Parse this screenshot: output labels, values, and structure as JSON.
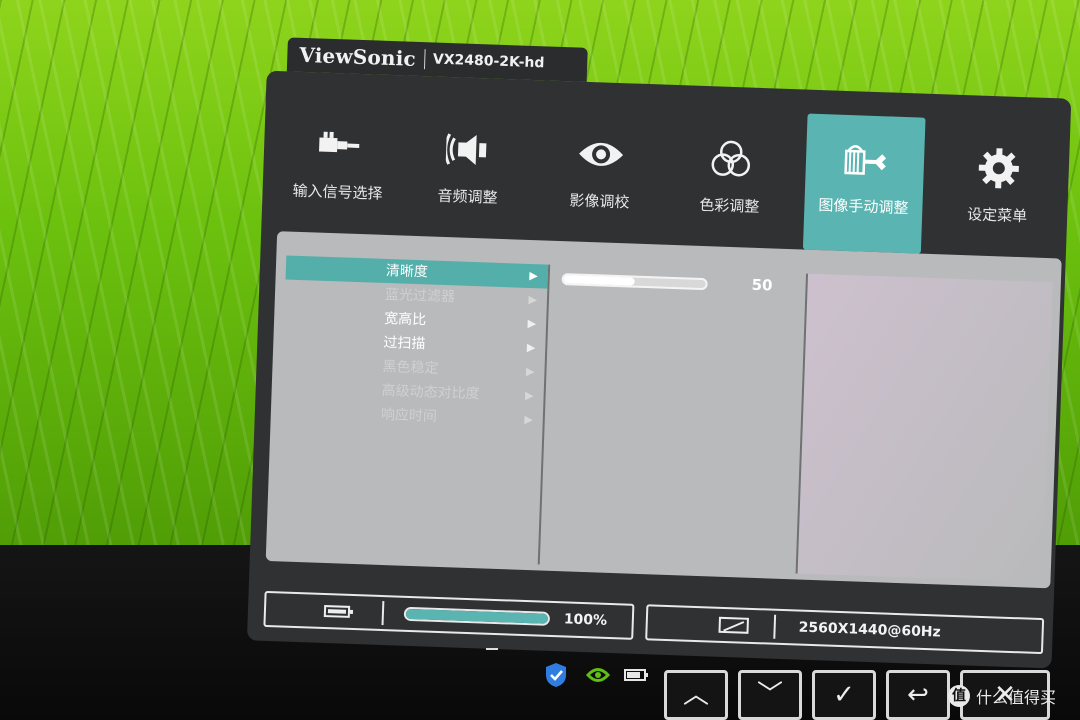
{
  "osd": {
    "brand": "ViewSonic",
    "model": "VX2480-2K-hd",
    "tabs": [
      {
        "label": "输入信号选择",
        "icon": "input-icon"
      },
      {
        "label": "音频调整",
        "icon": "speaker-icon"
      },
      {
        "label": "影像调校",
        "icon": "eye-icon"
      },
      {
        "label": "色彩调整",
        "icon": "color-circles-icon"
      },
      {
        "label": "图像手动调整",
        "icon": "manual-image-icon",
        "active": true
      },
      {
        "label": "设定菜单",
        "icon": "gear-icon"
      }
    ],
    "menu_items": [
      {
        "label": "清晰度",
        "state": "highlighted"
      },
      {
        "label": "蓝光过滤器",
        "state": "disabled"
      },
      {
        "label": "宽高比",
        "state": "enabled"
      },
      {
        "label": "过扫描",
        "state": "enabled"
      },
      {
        "label": "黑色稳定",
        "state": "disabled"
      },
      {
        "label": "高级动态对比度",
        "state": "disabled"
      },
      {
        "label": "响应时间",
        "state": "disabled"
      }
    ],
    "arrow_glyph": "▶",
    "sharpness": {
      "value": "50",
      "fraction": 0.5
    },
    "status": {
      "volume_fraction": 1.0,
      "volume_text": "100%",
      "resolution": "2560X1440@60Hz"
    }
  },
  "buttons": {
    "up": "︿",
    "down": "﹀",
    "ok": "✓",
    "back": "↩",
    "close": "✕"
  },
  "watermark": {
    "logo": "值",
    "text": "什么值得买"
  },
  "colors": {
    "accent": "#5ab4b1",
    "panel": "#2f3133",
    "content": "#b9babb"
  }
}
